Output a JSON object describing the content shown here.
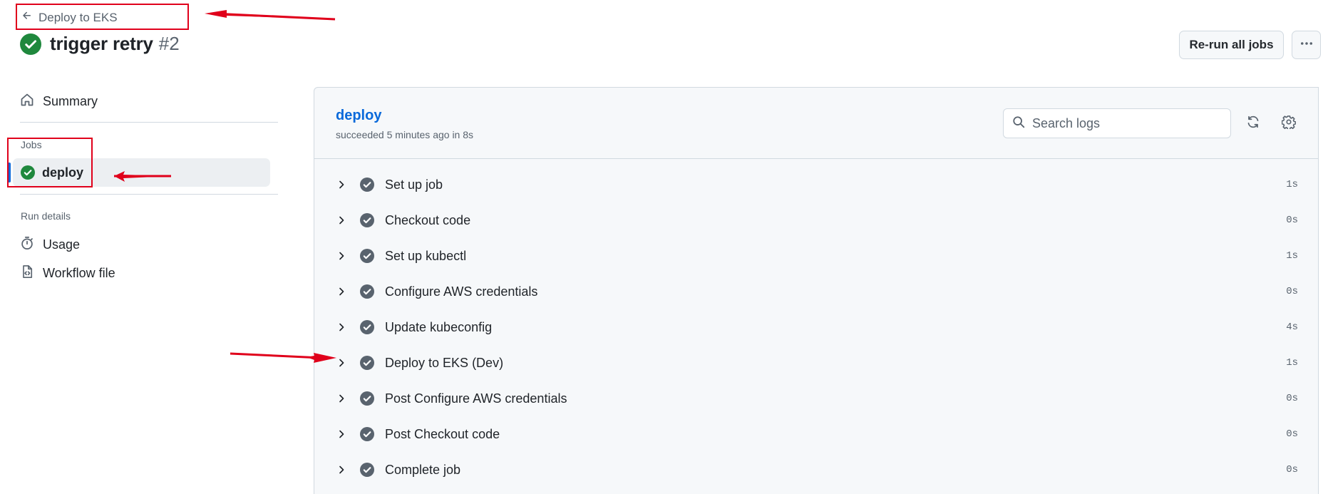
{
  "header": {
    "back_label": "Deploy to EKS",
    "run_title": "trigger retry",
    "run_number": "#2",
    "status": "success",
    "rerun_label": "Re-run all jobs",
    "more_icon": "kebab-horizontal-icon"
  },
  "sidebar": {
    "summary_label": "Summary",
    "jobs_heading": "Jobs",
    "jobs": [
      {
        "label": "deploy",
        "status": "success",
        "selected": true
      }
    ],
    "run_details_heading": "Run details",
    "run_details": [
      {
        "label": "Usage",
        "icon": "stopwatch-icon"
      },
      {
        "label": "Workflow file",
        "icon": "file-code-icon"
      }
    ]
  },
  "job": {
    "title": "deploy",
    "subtitle": "succeeded 5 minutes ago in 8s",
    "search_placeholder": "Search logs",
    "steps": [
      {
        "name": "Set up job",
        "duration": "1s"
      },
      {
        "name": "Checkout code",
        "duration": "0s"
      },
      {
        "name": "Set up kubectl",
        "duration": "1s"
      },
      {
        "name": "Configure AWS credentials",
        "duration": "0s"
      },
      {
        "name": "Update kubeconfig",
        "duration": "4s"
      },
      {
        "name": "Deploy to EKS (Dev)",
        "duration": "1s"
      },
      {
        "name": "Post Configure AWS credentials",
        "duration": "0s"
      },
      {
        "name": "Post Checkout code",
        "duration": "0s"
      },
      {
        "name": "Complete job",
        "duration": "0s"
      }
    ]
  },
  "colors": {
    "success": "#1f883d",
    "step_check": "#59636e",
    "link": "#0969da",
    "annotation": "#e0001b"
  }
}
